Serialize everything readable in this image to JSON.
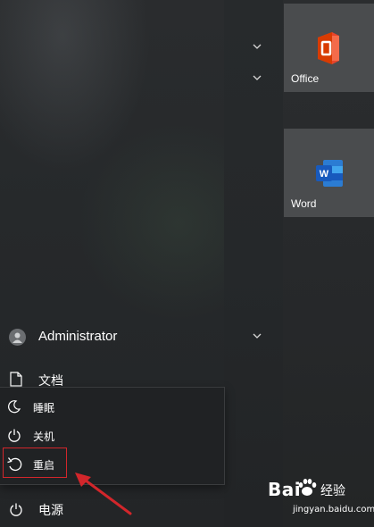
{
  "start_menu": {
    "user": {
      "name": "Administrator",
      "avatar_icon": "user-avatar-icon"
    },
    "documents": {
      "label": "文档",
      "icon": "document-icon"
    },
    "power_menu": {
      "items": [
        {
          "label": "睡眠",
          "icon": "sleep-moon-icon"
        },
        {
          "label": "关机",
          "icon": "power-icon"
        },
        {
          "label": "重启",
          "icon": "restart-icon"
        }
      ]
    },
    "power": {
      "label": "电源",
      "icon": "power-icon"
    },
    "tiles": [
      {
        "label": "Office",
        "icon": "office-icon"
      },
      {
        "label": "Word",
        "icon": "word-icon"
      }
    ]
  },
  "annotation": {
    "highlight_color": "#d2262b",
    "arrow_color": "#d2262b"
  },
  "watermark": {
    "brand_left": "Bai",
    "brand_right": "经验",
    "url": "jingyan.baidu.com"
  }
}
